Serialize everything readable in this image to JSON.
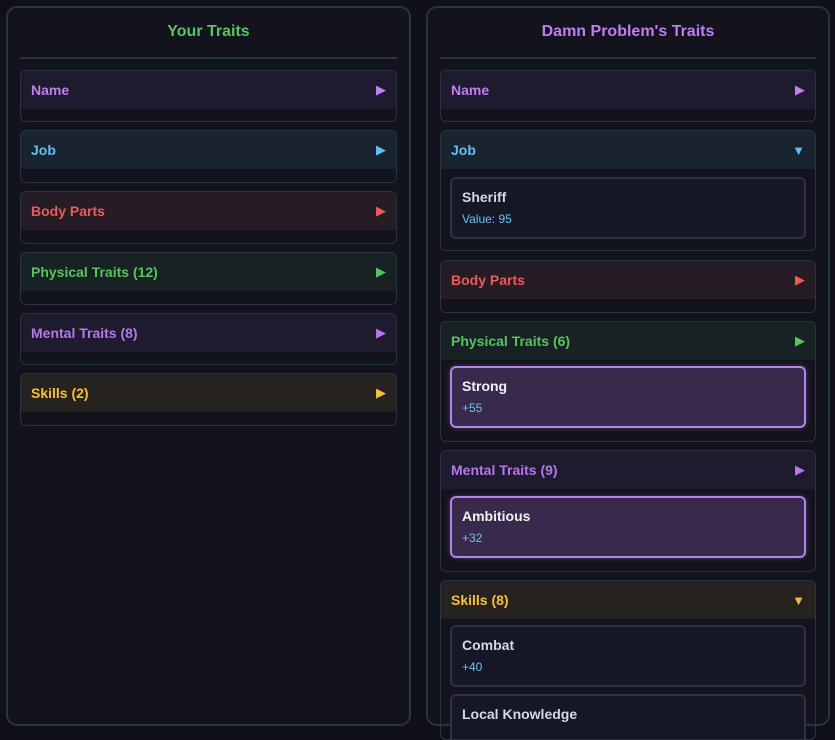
{
  "your_traits": {
    "title": "Your Traits",
    "sections": [
      {
        "label": "Name",
        "arrow": "▶"
      },
      {
        "label": "Job",
        "arrow": "▶"
      },
      {
        "label": "Body Parts",
        "arrow": "▶"
      },
      {
        "label": "Physical Traits (12)",
        "arrow": "▶"
      },
      {
        "label": "Mental Traits (8)",
        "arrow": "▶"
      },
      {
        "label": "Skills (2)",
        "arrow": "▶"
      }
    ]
  },
  "opponent_traits": {
    "title": "Damn Problem's Traits",
    "sections": [
      {
        "label": "Name",
        "arrow": "▶"
      },
      {
        "label": "Job",
        "arrow": "▼",
        "items": [
          {
            "title": "Sheriff",
            "value": "Value: 95"
          }
        ]
      },
      {
        "label": "Body Parts",
        "arrow": "▶"
      },
      {
        "label": "Physical Traits (6)",
        "arrow": "▶",
        "items": [
          {
            "title": "Strong",
            "value": "+55"
          }
        ]
      },
      {
        "label": "Mental Traits (9)",
        "arrow": "▶",
        "items": [
          {
            "title": "Ambitious",
            "value": "+32"
          }
        ]
      },
      {
        "label": "Skills (8)",
        "arrow": "▼",
        "items": [
          {
            "title": "Combat",
            "value": "+40"
          },
          {
            "title": "Local Knowledge",
            "value": ""
          }
        ]
      }
    ]
  },
  "colors": {
    "name": "#c07ef0",
    "job": "#62bff0",
    "body_parts": "#ec5a5c",
    "physical": "#58c45f",
    "mental": "#b776ec",
    "skills": "#f3c13a",
    "highlight_border": "#b584e8"
  }
}
